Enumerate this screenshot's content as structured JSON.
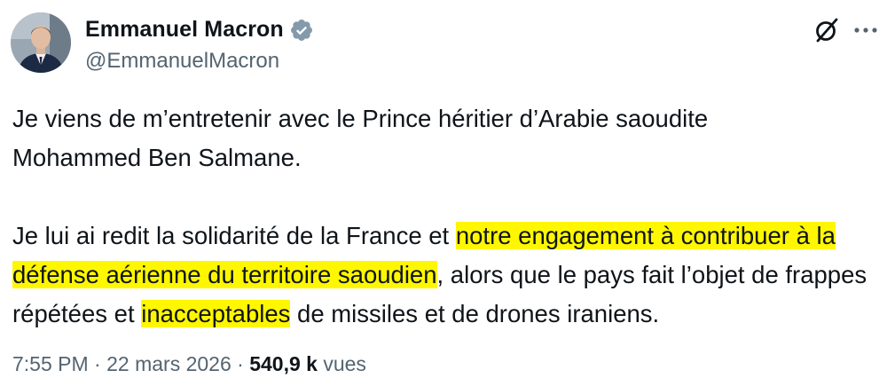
{
  "author": {
    "display_name": "Emmanuel Macron",
    "handle": "@EmmanuelMacron",
    "verified": true,
    "verified_badge_color": "#829aab",
    "avatar_icon": "profile-photo"
  },
  "header_actions": {
    "grok_icon": "grok-icon",
    "more_icon": "more-icon"
  },
  "tweet": {
    "para1_line1": "Je viens de m’entretenir avec le Prince héritier d’Arabie saoudite",
    "para1_line2": "Mohammed Ben Salmane.",
    "para2_seg1": "Je lui ai redit la solidarité de la France et ",
    "para2_hl1": "notre engagement à contribuer à la défense aérienne du territoire saoudien",
    "para2_seg2": ", alors que le pays fait l’objet de frappes répétées et ",
    "para2_hl2": "inacceptables",
    "para2_seg3": " de missiles et de drones iraniens.",
    "highlight_color": "#fff700"
  },
  "meta": {
    "time": "7:55 PM",
    "separator1": " · ",
    "date": "22 mars 2026",
    "separator2": " · ",
    "views_count": "540,9 k",
    "views_label": " vues"
  }
}
